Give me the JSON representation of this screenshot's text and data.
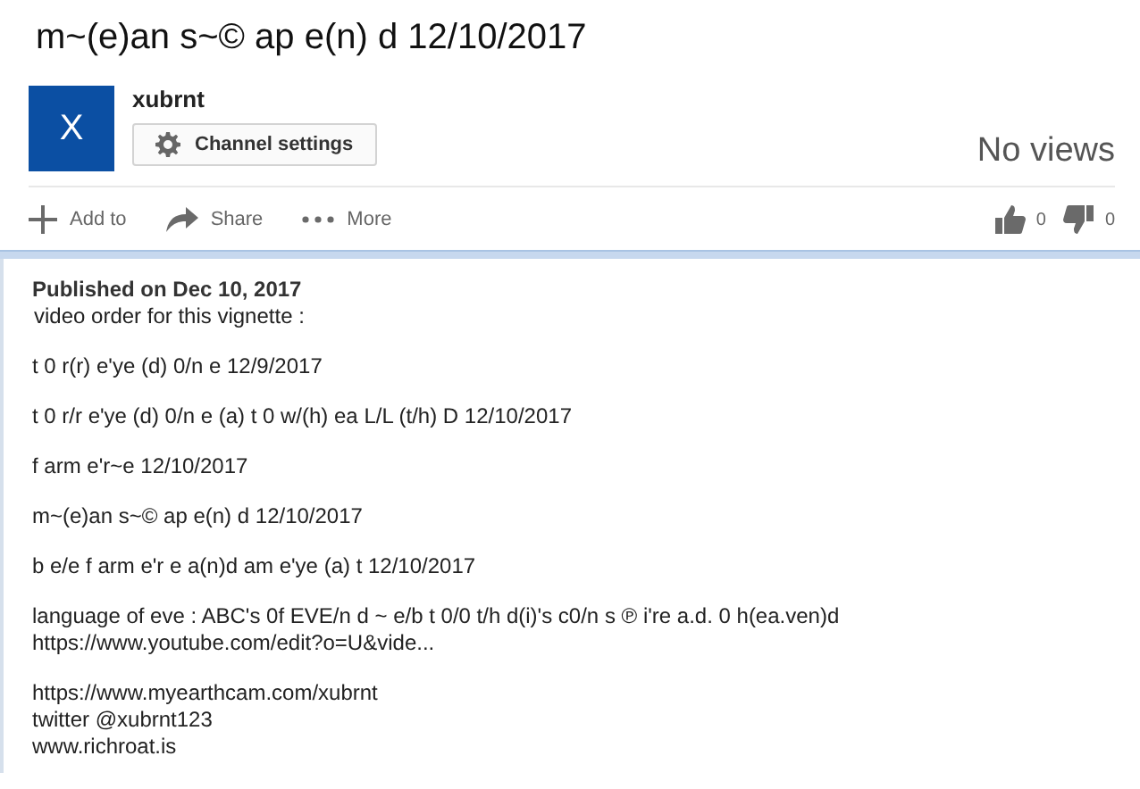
{
  "title": "m~(e)an s~© ap e(n) d 12/10/2017",
  "channel": {
    "avatar_letter": "X",
    "name": "xubrnt",
    "settings_button": "Channel settings"
  },
  "views": "No views",
  "actions": [
    {
      "kind": "add",
      "label": "Add to"
    },
    {
      "kind": "share",
      "label": "Share"
    },
    {
      "kind": "more",
      "label": "More"
    }
  ],
  "ratings": [
    {
      "kind": "like",
      "count": "0"
    },
    {
      "kind": "dislike",
      "count": "0"
    }
  ],
  "published": "Published on Dec 10, 2017",
  "description": [
    [
      "video order for this vignette :"
    ],
    [
      "t 0 r(r) e'ye (d) 0/n e 12/9/2017"
    ],
    [
      "t 0 r/r e'ye (d) 0/n e (a) t 0 w/(h) ea L/L (t/h) D 12/10/2017"
    ],
    [
      "f arm e'r~e 12/10/2017"
    ],
    [
      "m~(e)an s~© ap e(n) d 12/10/2017"
    ],
    [
      "b e/e f arm e'r e a(n)d am e'ye (a) t 12/10/2017"
    ],
    [
      "language of eve : ABC's 0f EVE/n d ~ e/b t 0/0 t/h d(i)'s c0/n s ℗ i're a.d. 0 h(ea.ven)d",
      "https://www.youtube.com/edit?o=U&vide..."
    ],
    [
      "https://www.myearthcam.com/xubrnt",
      "twitter @xubrnt123",
      "www.richroat.is"
    ]
  ]
}
